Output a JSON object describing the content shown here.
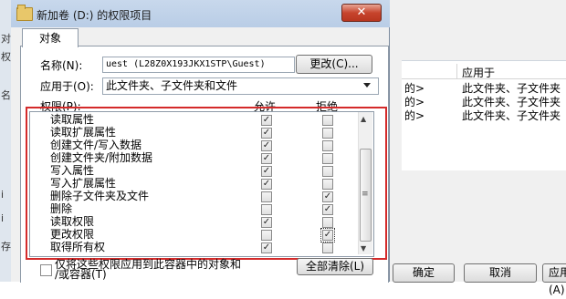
{
  "background_window": {
    "left_fragments": [
      "对",
      "权",
      "名",
      "i",
      "i",
      "存"
    ],
    "column_header": "应用于",
    "rows": [
      {
        "arrow": "的>",
        "applies": "此文件夹、子文件夹"
      },
      {
        "arrow": "的>",
        "applies": "此文件夹、子文件夹"
      },
      {
        "arrow": "的>",
        "applies": "此文件夹、子文件夹"
      }
    ],
    "buttons": {
      "ok": "确定",
      "cancel": "取消",
      "apply": "应用(A)"
    }
  },
  "dialog": {
    "title": "新加卷 (D:) 的权限项目",
    "close": "✕",
    "tab": "对象",
    "name_label": "名称(N):",
    "name_value": "uest (L28Z0X193JKX1STP\\Guest)",
    "change_button": "更改(C)...",
    "applies_label": "应用于(O):",
    "applies_value": "此文件夹、子文件夹和文件",
    "permissions_label": "权限(P):",
    "allow_header": "允许",
    "deny_header": "拒绝",
    "permissions": [
      {
        "label": "读取属性",
        "allow": true,
        "deny": false
      },
      {
        "label": "读取扩展属性",
        "allow": true,
        "deny": false
      },
      {
        "label": "创建文件/写入数据",
        "allow": true,
        "deny": false
      },
      {
        "label": "创建文件夹/附加数据",
        "allow": true,
        "deny": false
      },
      {
        "label": "写入属性",
        "allow": true,
        "deny": false
      },
      {
        "label": "写入扩展属性",
        "allow": true,
        "deny": false
      },
      {
        "label": "删除子文件夹及文件",
        "allow": false,
        "deny": true
      },
      {
        "label": "删除",
        "allow": false,
        "deny": true
      },
      {
        "label": "读取权限",
        "allow": true,
        "deny": false
      },
      {
        "label": "更改权限",
        "allow": false,
        "deny": true
      },
      {
        "label": "取得所有权",
        "allow": true,
        "deny": false
      }
    ],
    "only_apply_text_line1": "仅将这些权限应用到此容器中的对象和",
    "only_apply_text_line2": "/或容器(T)",
    "clear_all_button": "全部清除(L)"
  },
  "colors": {
    "highlight_border": "#d42a2a",
    "close_button": "#c7442d"
  }
}
